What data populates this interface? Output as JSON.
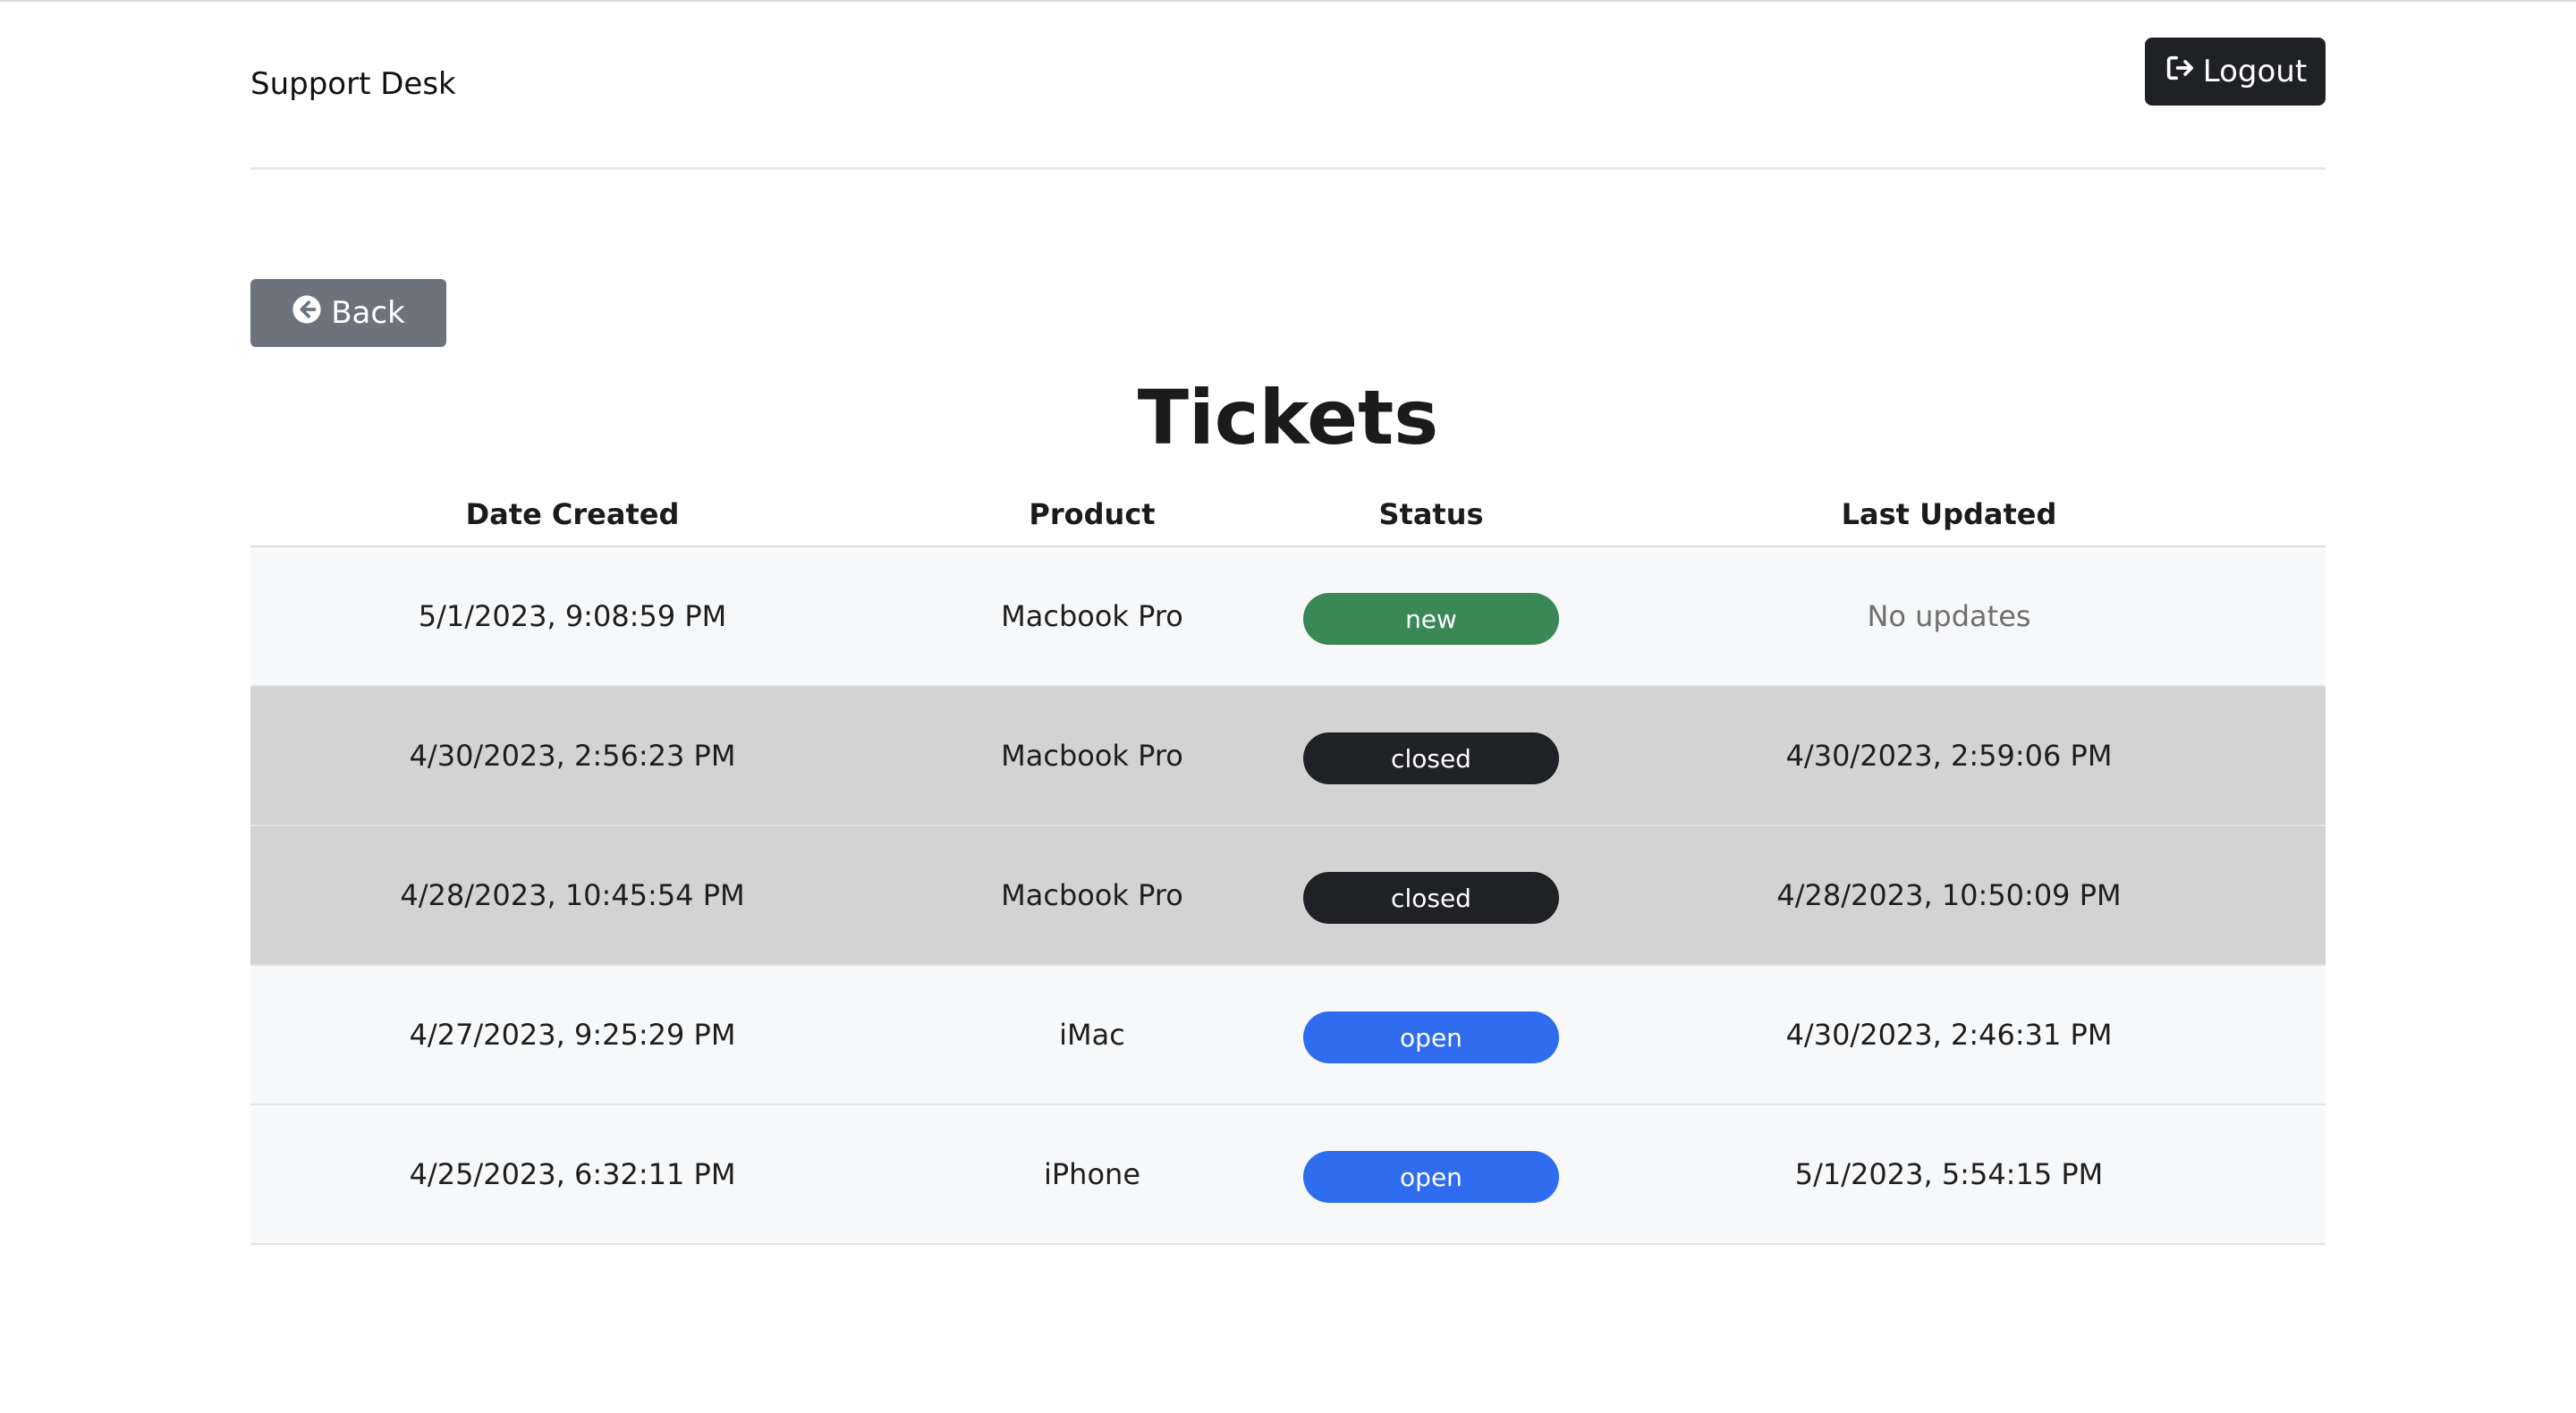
{
  "header": {
    "brand": "Support Desk",
    "logout_label": "Logout",
    "logout_icon": "sign-out-icon"
  },
  "back_button": {
    "label": "Back",
    "icon": "arrow-circle-left-icon"
  },
  "page_title": "Tickets",
  "table": {
    "columns": [
      "Date Created",
      "Product",
      "Status",
      "Last Updated"
    ],
    "rows": [
      {
        "created": "5/1/2023, 9:08:59 PM",
        "product": "Macbook Pro",
        "status": "new",
        "status_color": "#3a8856",
        "updated": "No updates",
        "shaded": false
      },
      {
        "created": "4/30/2023, 2:56:23 PM",
        "product": "Macbook Pro",
        "status": "closed",
        "status_color": "#1f2125",
        "updated": "4/30/2023, 2:59:06 PM",
        "shaded": true
      },
      {
        "created": "4/28/2023, 10:45:54 PM",
        "product": "Macbook Pro",
        "status": "closed",
        "status_color": "#1f2125",
        "updated": "4/28/2023, 10:50:09 PM",
        "shaded": true
      },
      {
        "created": "4/27/2023, 9:25:29 PM",
        "product": "iMac",
        "status": "open",
        "status_color": "#2f6cf0",
        "updated": "4/30/2023, 2:46:31 PM",
        "shaded": false
      },
      {
        "created": "4/25/2023, 6:32:11 PM",
        "product": "iPhone",
        "status": "open",
        "status_color": "#2f6cf0",
        "updated": "5/1/2023, 5:54:15 PM",
        "shaded": false
      }
    ]
  }
}
